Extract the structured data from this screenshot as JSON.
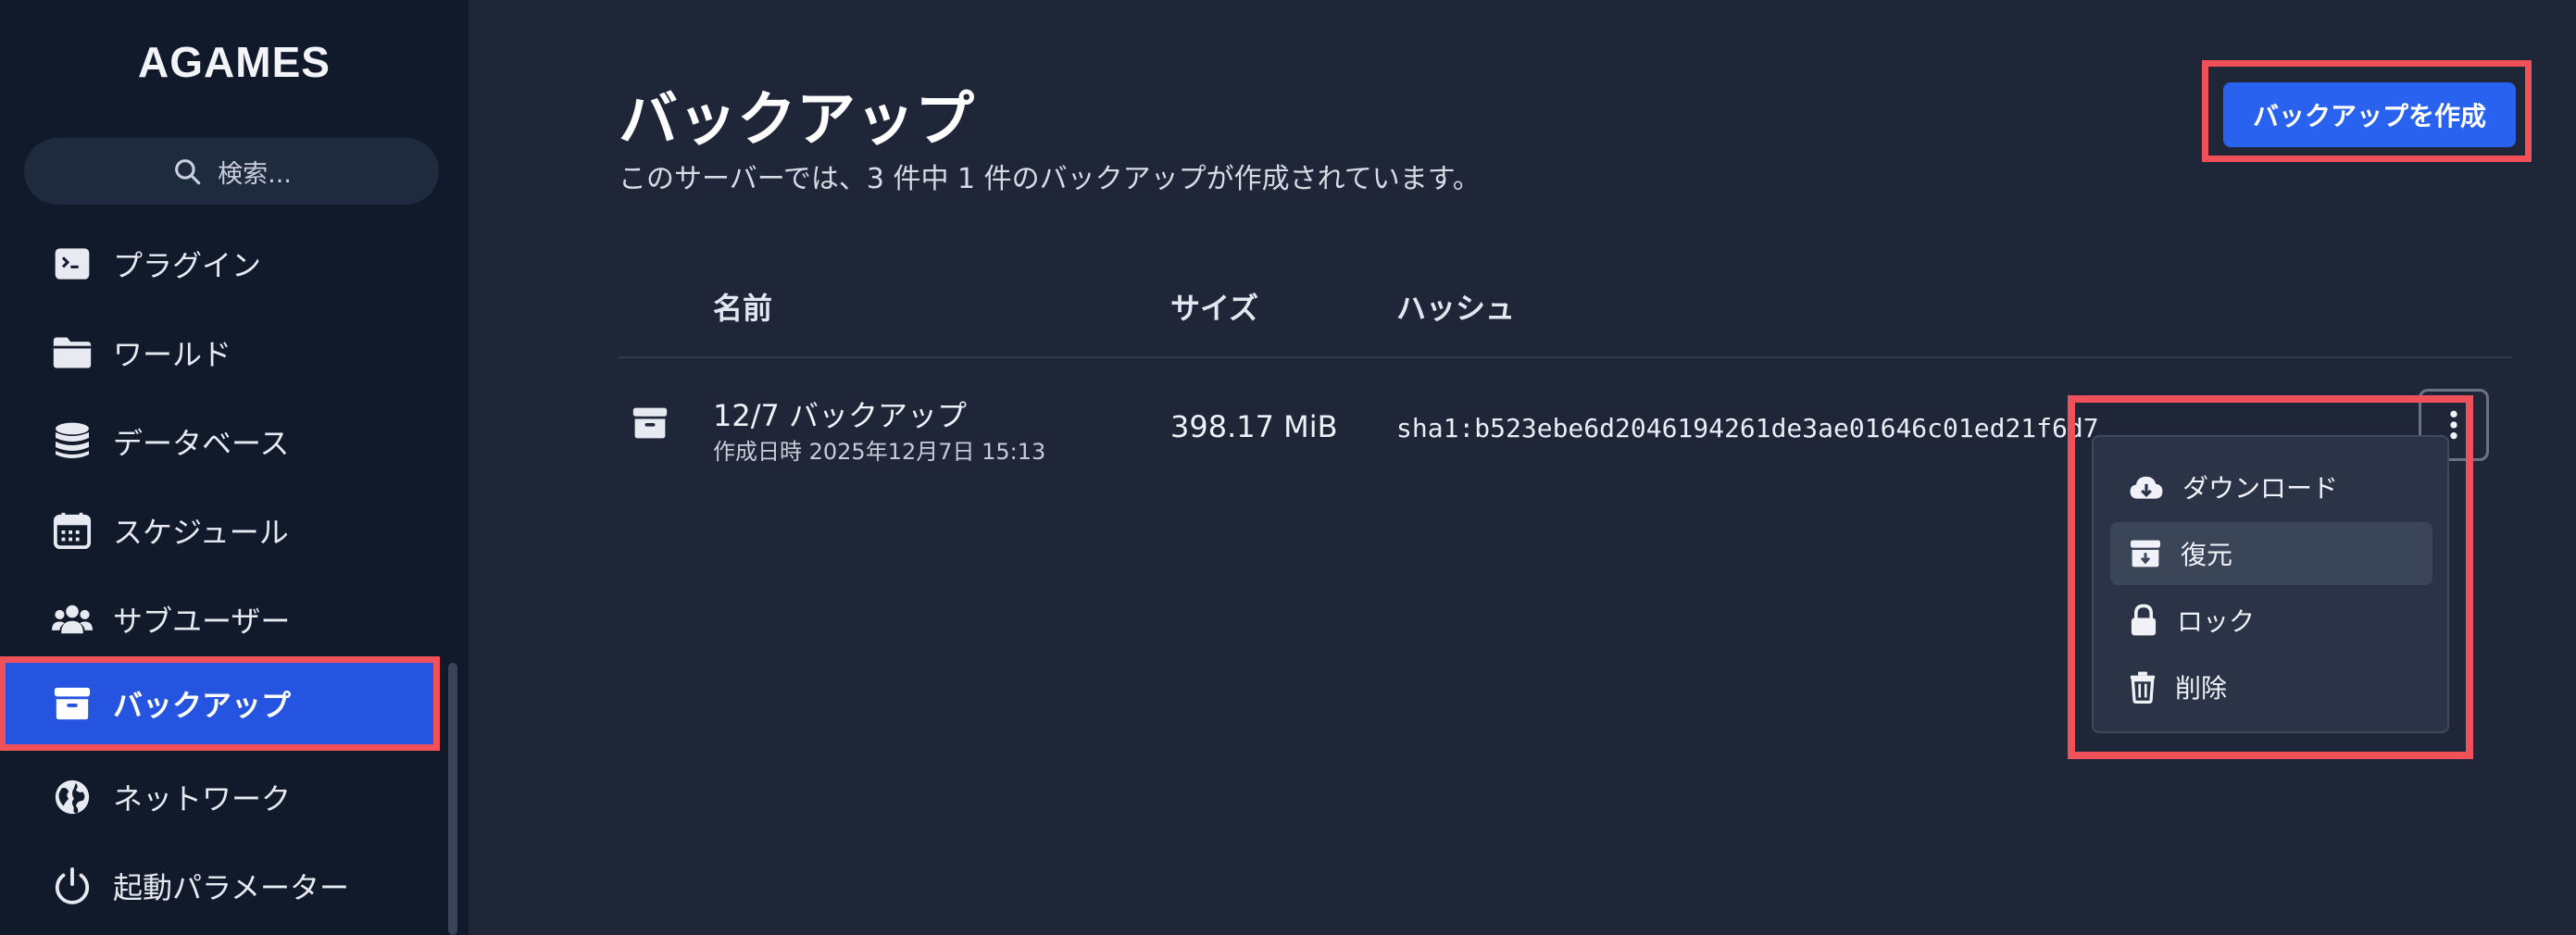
{
  "sidebar": {
    "logo": "AGAMES",
    "search_placeholder": "検索...",
    "items": [
      {
        "label": "プラグイン",
        "icon": "terminal-icon"
      },
      {
        "label": "ワールド",
        "icon": "folder-icon"
      },
      {
        "label": "データベース",
        "icon": "database-icon"
      },
      {
        "label": "スケジュール",
        "icon": "calendar-icon"
      },
      {
        "label": "サブユーザー",
        "icon": "users-icon"
      },
      {
        "label": "バックアップ",
        "icon": "archive-icon",
        "active": true
      },
      {
        "label": "ネットワーク",
        "icon": "globe-icon"
      },
      {
        "label": "起動パラメーター",
        "icon": "power-icon"
      }
    ]
  },
  "main": {
    "title": "バックアップ",
    "subtitle": "このサーバーでは、3 件中 1 件のバックアップが作成されています。",
    "create_button": "バックアップを作成",
    "columns": [
      "名前",
      "サイズ",
      "ハッシュ"
    ],
    "backups": [
      {
        "name": "12/7 バックアップ",
        "created": "作成日時 2025年12月7日 15:13",
        "size": "398.17 MiB",
        "hash": "sha1:b523ebe6d2046194261de3ae01646c01ed21f6d7"
      }
    ]
  },
  "context_menu": {
    "items": [
      {
        "label": "ダウンロード",
        "icon": "cloud-download-icon"
      },
      {
        "label": "復元",
        "icon": "archive-restore-icon",
        "hovered": true
      },
      {
        "label": "ロック",
        "icon": "lock-icon"
      },
      {
        "label": "削除",
        "icon": "trash-icon"
      }
    ]
  },
  "colors": {
    "accent": "#2454e0",
    "highlight": "#ef5059",
    "background": "#1f2638",
    "sidebar": "#111a2b"
  }
}
